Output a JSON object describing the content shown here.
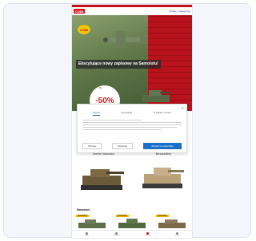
{
  "header": {
    "logo": "COBI",
    "links": [
      "Szukaj",
      "Zaloguj się"
    ]
  },
  "hero": {
    "logo": "COBI",
    "headline": "Ekscytujące nowy zapisowy na Samolotu!",
    "sale_text": "-50%",
    "sale_small": "Do"
  },
  "dialog": {
    "close": "✕",
    "tabs": [
      "Zgoda",
      "Szczegóły",
      "O plikach cookie"
    ],
    "buttons": {
      "left": "Odmów",
      "middle": "Dostosuj",
      "primary": "Zezwól na wszystkie"
    }
  },
  "sections": [
    "Letnie Nowości",
    "Bestsellery"
  ],
  "bestsellers": {
    "title": "Nowości",
    "tags": [
      "NOWOŚĆ",
      "NOWOŚĆ",
      "NOWOŚĆ"
    ]
  },
  "bottom_nav": [
    "Sklep",
    "Ulubione",
    "Koszyk",
    "Konto"
  ],
  "colors": {
    "brand_red": "#c7111a",
    "primary_button": "#1a6fc9",
    "tag_yellow": "#f2b300"
  }
}
